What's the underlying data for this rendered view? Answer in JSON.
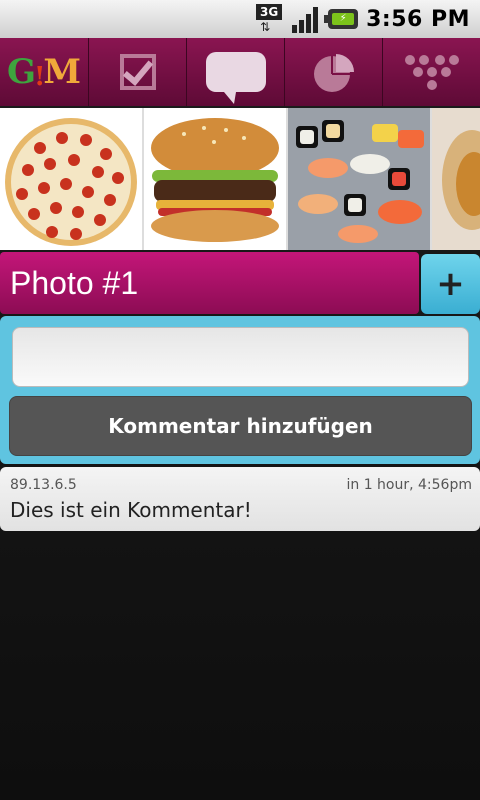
{
  "status_bar": {
    "network": "3G",
    "network_arrows": "⇅",
    "signal_level": 4,
    "battery_icon": "battery-charging-icon",
    "time": "3:56 PM"
  },
  "app": {
    "logo_letters": "G!M",
    "tabs": [
      {
        "icon": "checklist-icon",
        "active": false
      },
      {
        "icon": "comments-icon",
        "active": true
      },
      {
        "icon": "pie-chart-icon",
        "active": false
      },
      {
        "icon": "network-dots-icon",
        "active": false
      }
    ]
  },
  "photos": [
    {
      "icon": "pizza-photo"
    },
    {
      "icon": "burger-photo"
    },
    {
      "icon": "sushi-photo"
    },
    {
      "icon": "wrap-photo"
    }
  ],
  "photo_title": "Photo #1",
  "add_button_label": "+",
  "comment_form": {
    "input_value": "",
    "submit_label": "Kommentar hinzufügen"
  },
  "comments": [
    {
      "author_ip": "89.13.6.5",
      "time": "in 1 hour, 4:56pm",
      "text": "Dies ist ein Kommentar!"
    }
  ],
  "colors": {
    "nav_bg": "#7a1045",
    "title_bg": "#b01469",
    "accent_blue": "#5fc4e0",
    "button_dark": "#555555"
  }
}
